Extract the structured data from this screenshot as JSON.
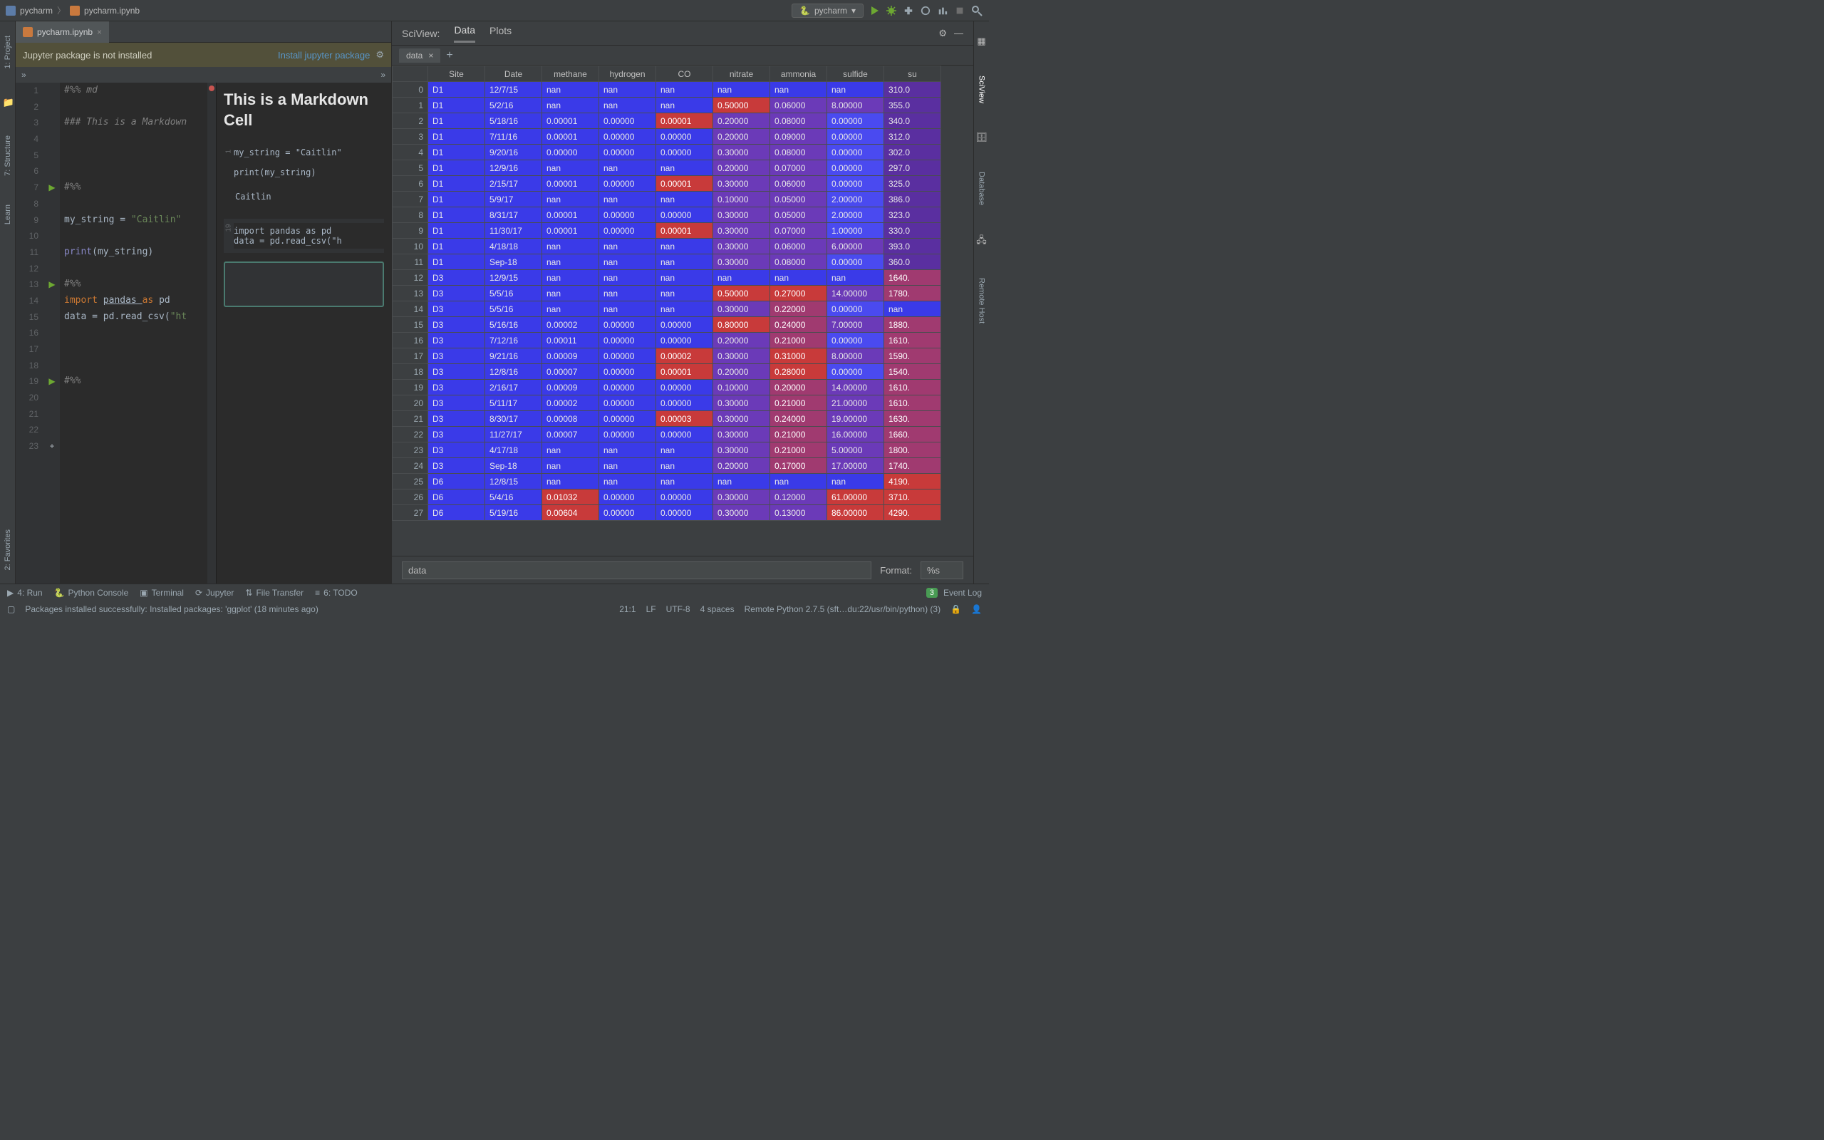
{
  "breadcrumb": {
    "project": "pycharm",
    "file": "pycharm.ipynb"
  },
  "interpreter_chip": "pycharm",
  "left_strip": {
    "project": "1: Project",
    "structure": "7: Structure",
    "learn": "Learn",
    "favorites": "2: Favorites"
  },
  "right_strip": {
    "sciview": "SciView",
    "database": "Database",
    "remote_host": "Remote Host"
  },
  "tabs": {
    "editor": "pycharm.ipynb"
  },
  "notice": {
    "msg": "Jupyter package is not installed",
    "link": "Install jupyter package"
  },
  "crumb": {
    "left": "»",
    "right": "»"
  },
  "gutter_numbers": [
    "1",
    "2",
    "3",
    "4",
    "5",
    "6",
    "7",
    "8",
    "9",
    "10",
    "11",
    "12",
    "13",
    "14",
    "15",
    "16",
    "17",
    "18",
    "19",
    "20",
    "21",
    "22",
    "23"
  ],
  "code": {
    "l1": "#%% md",
    "l3": "### This is a Markdown",
    "l7": "#%%",
    "l9a": "my_string = ",
    "l9b": "\"Caitlin\"",
    "l11a": "print",
    "l11b": "(my_string)",
    "l13": "#%%",
    "l14a": "import ",
    "l14b": "pandas ",
    "l14c": "as ",
    "l14d": "pd",
    "l15a": "data = pd.read_csv(",
    "l15b": "\"ht",
    "l19": "#%%"
  },
  "preview": {
    "heading": "This is a Markdown Cell",
    "label1": "1",
    "code1": "my_string = \"Caitlin\"\n\nprint(my_string)",
    "out1": "Caitlin",
    "label2": "19",
    "code2": "import pandas as pd\ndata = pd.read_csv(\"h"
  },
  "sciview": {
    "title": "SciView:",
    "tab_data": "Data",
    "tab_plots": "Plots",
    "data_tab": "data"
  },
  "grid": {
    "headers": [
      "",
      "Site",
      "Date",
      "methane",
      "hydrogen",
      "CO",
      "nitrate",
      "ammonia",
      "sulfide",
      "su"
    ],
    "rows": [
      {
        "i": 0,
        "site": "D1",
        "date": "12/7/15",
        "methane": "nan",
        "hydrogen": "nan",
        "co": "nan",
        "nitrate": "nan",
        "ammonia": "nan",
        "sulfide": "nan",
        "sul": "310.0"
      },
      {
        "i": 1,
        "site": "D1",
        "date": "5/2/16",
        "methane": "nan",
        "hydrogen": "nan",
        "co": "nan",
        "nitrate": "0.50000",
        "ammonia": "0.06000",
        "sulfide": "8.00000",
        "sul": "355.0"
      },
      {
        "i": 2,
        "site": "D1",
        "date": "5/18/16",
        "methane": "0.00001",
        "hydrogen": "0.00000",
        "co": "0.00001",
        "nitrate": "0.20000",
        "ammonia": "0.08000",
        "sulfide": "0.00000",
        "sul": "340.0"
      },
      {
        "i": 3,
        "site": "D1",
        "date": "7/11/16",
        "methane": "0.00001",
        "hydrogen": "0.00000",
        "co": "0.00000",
        "nitrate": "0.20000",
        "ammonia": "0.09000",
        "sulfide": "0.00000",
        "sul": "312.0"
      },
      {
        "i": 4,
        "site": "D1",
        "date": "9/20/16",
        "methane": "0.00000",
        "hydrogen": "0.00000",
        "co": "0.00000",
        "nitrate": "0.30000",
        "ammonia": "0.08000",
        "sulfide": "0.00000",
        "sul": "302.0"
      },
      {
        "i": 5,
        "site": "D1",
        "date": "12/9/16",
        "methane": "nan",
        "hydrogen": "nan",
        "co": "nan",
        "nitrate": "0.20000",
        "ammonia": "0.07000",
        "sulfide": "0.00000",
        "sul": "297.0"
      },
      {
        "i": 6,
        "site": "D1",
        "date": "2/15/17",
        "methane": "0.00001",
        "hydrogen": "0.00000",
        "co": "0.00001",
        "nitrate": "0.30000",
        "ammonia": "0.06000",
        "sulfide": "0.00000",
        "sul": "325.0"
      },
      {
        "i": 7,
        "site": "D1",
        "date": "5/9/17",
        "methane": "nan",
        "hydrogen": "nan",
        "co": "nan",
        "nitrate": "0.10000",
        "ammonia": "0.05000",
        "sulfide": "2.00000",
        "sul": "386.0"
      },
      {
        "i": 8,
        "site": "D1",
        "date": "8/31/17",
        "methane": "0.00001",
        "hydrogen": "0.00000",
        "co": "0.00000",
        "nitrate": "0.30000",
        "ammonia": "0.05000",
        "sulfide": "2.00000",
        "sul": "323.0"
      },
      {
        "i": 9,
        "site": "D1",
        "date": "11/30/17",
        "methane": "0.00001",
        "hydrogen": "0.00000",
        "co": "0.00001",
        "nitrate": "0.30000",
        "ammonia": "0.07000",
        "sulfide": "1.00000",
        "sul": "330.0"
      },
      {
        "i": 10,
        "site": "D1",
        "date": "4/18/18",
        "methane": "nan",
        "hydrogen": "nan",
        "co": "nan",
        "nitrate": "0.30000",
        "ammonia": "0.06000",
        "sulfide": "6.00000",
        "sul": "393.0"
      },
      {
        "i": 11,
        "site": "D1",
        "date": "Sep-18",
        "methane": "nan",
        "hydrogen": "nan",
        "co": "nan",
        "nitrate": "0.30000",
        "ammonia": "0.08000",
        "sulfide": "0.00000",
        "sul": "360.0"
      },
      {
        "i": 12,
        "site": "D3",
        "date": "12/9/15",
        "methane": "nan",
        "hydrogen": "nan",
        "co": "nan",
        "nitrate": "nan",
        "ammonia": "nan",
        "sulfide": "nan",
        "sul": "1640."
      },
      {
        "i": 13,
        "site": "D3",
        "date": "5/5/16",
        "methane": "nan",
        "hydrogen": "nan",
        "co": "nan",
        "nitrate": "0.50000",
        "ammonia": "0.27000",
        "sulfide": "14.00000",
        "sul": "1780."
      },
      {
        "i": 14,
        "site": "D3",
        "date": "5/5/16",
        "methane": "nan",
        "hydrogen": "nan",
        "co": "nan",
        "nitrate": "0.30000",
        "ammonia": "0.22000",
        "sulfide": "0.00000",
        "sul": "nan"
      },
      {
        "i": 15,
        "site": "D3",
        "date": "5/16/16",
        "methane": "0.00002",
        "hydrogen": "0.00000",
        "co": "0.00000",
        "nitrate": "0.80000",
        "ammonia": "0.24000",
        "sulfide": "7.00000",
        "sul": "1880."
      },
      {
        "i": 16,
        "site": "D3",
        "date": "7/12/16",
        "methane": "0.00011",
        "hydrogen": "0.00000",
        "co": "0.00000",
        "nitrate": "0.20000",
        "ammonia": "0.21000",
        "sulfide": "0.00000",
        "sul": "1610."
      },
      {
        "i": 17,
        "site": "D3",
        "date": "9/21/16",
        "methane": "0.00009",
        "hydrogen": "0.00000",
        "co": "0.00002",
        "nitrate": "0.30000",
        "ammonia": "0.31000",
        "sulfide": "8.00000",
        "sul": "1590."
      },
      {
        "i": 18,
        "site": "D3",
        "date": "12/8/16",
        "methane": "0.00007",
        "hydrogen": "0.00000",
        "co": "0.00001",
        "nitrate": "0.20000",
        "ammonia": "0.28000",
        "sulfide": "0.00000",
        "sul": "1540."
      },
      {
        "i": 19,
        "site": "D3",
        "date": "2/16/17",
        "methane": "0.00009",
        "hydrogen": "0.00000",
        "co": "0.00000",
        "nitrate": "0.10000",
        "ammonia": "0.20000",
        "sulfide": "14.00000",
        "sul": "1610."
      },
      {
        "i": 20,
        "site": "D3",
        "date": "5/11/17",
        "methane": "0.00002",
        "hydrogen": "0.00000",
        "co": "0.00000",
        "nitrate": "0.30000",
        "ammonia": "0.21000",
        "sulfide": "21.00000",
        "sul": "1610."
      },
      {
        "i": 21,
        "site": "D3",
        "date": "8/30/17",
        "methane": "0.00008",
        "hydrogen": "0.00000",
        "co": "0.00003",
        "nitrate": "0.30000",
        "ammonia": "0.24000",
        "sulfide": "19.00000",
        "sul": "1630."
      },
      {
        "i": 22,
        "site": "D3",
        "date": "11/27/17",
        "methane": "0.00007",
        "hydrogen": "0.00000",
        "co": "0.00000",
        "nitrate": "0.30000",
        "ammonia": "0.21000",
        "sulfide": "16.00000",
        "sul": "1660."
      },
      {
        "i": 23,
        "site": "D3",
        "date": "4/17/18",
        "methane": "nan",
        "hydrogen": "nan",
        "co": "nan",
        "nitrate": "0.30000",
        "ammonia": "0.21000",
        "sulfide": "5.00000",
        "sul": "1800."
      },
      {
        "i": 24,
        "site": "D3",
        "date": "Sep-18",
        "methane": "nan",
        "hydrogen": "nan",
        "co": "nan",
        "nitrate": "0.20000",
        "ammonia": "0.17000",
        "sulfide": "17.00000",
        "sul": "1740."
      },
      {
        "i": 25,
        "site": "D6",
        "date": "12/8/15",
        "methane": "nan",
        "hydrogen": "nan",
        "co": "nan",
        "nitrate": "nan",
        "ammonia": "nan",
        "sulfide": "nan",
        "sul": "4190."
      },
      {
        "i": 26,
        "site": "D6",
        "date": "5/4/16",
        "methane": "0.01032",
        "hydrogen": "0.00000",
        "co": "0.00000",
        "nitrate": "0.30000",
        "ammonia": "0.12000",
        "sulfide": "61.00000",
        "sul": "3710."
      },
      {
        "i": 27,
        "site": "D6",
        "date": "5/19/16",
        "methane": "0.00604",
        "hydrogen": "0.00000",
        "co": "0.00000",
        "nitrate": "0.30000",
        "ammonia": "0.13000",
        "sulfide": "86.00000",
        "sul": "4290."
      }
    ]
  },
  "inspect": {
    "value": "data",
    "format_label": "Format:",
    "format_value": "%s"
  },
  "bottom_tw": {
    "run": "4: Run",
    "pyconsole": "Python Console",
    "terminal": "Terminal",
    "jupyter": "Jupyter",
    "file_transfer": "File Transfer",
    "todo": "6: TODO",
    "event_log": "Event Log",
    "event_badge": "3"
  },
  "status": {
    "msg": "Packages installed successfully: Installed packages: 'ggplot' (18 minutes ago)",
    "pos": "21:1",
    "le": "LF",
    "enc": "UTF-8",
    "indent": "4 spaces",
    "interp": "Remote Python 2.7.5 (sft…du:22/usr/bin/python) (3)"
  }
}
